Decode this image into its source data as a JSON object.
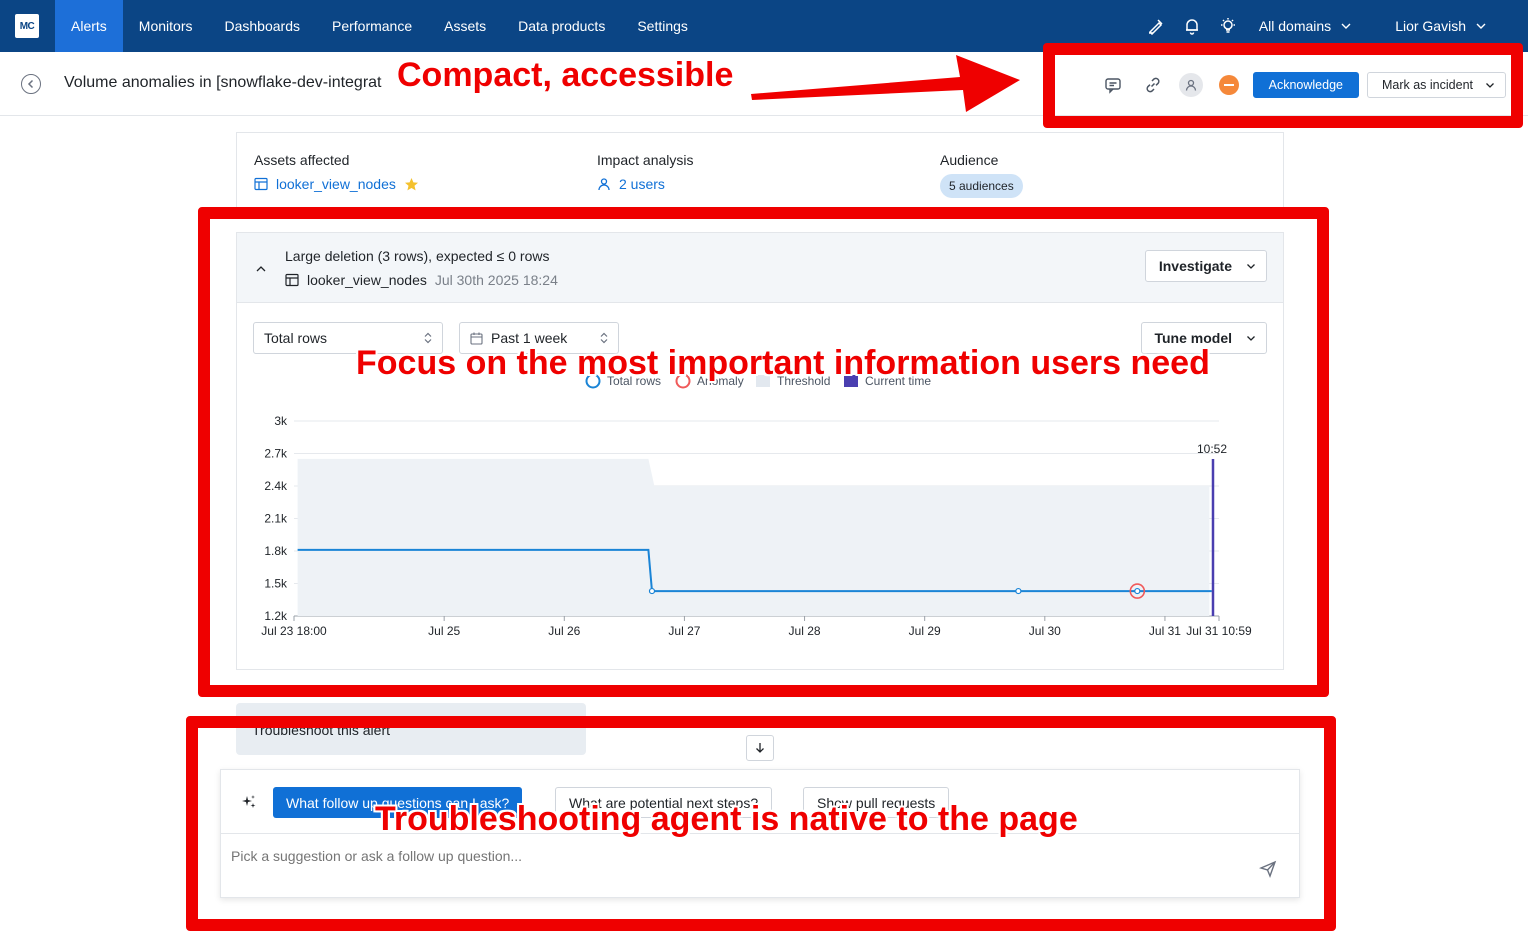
{
  "nav": {
    "logo": "MC",
    "items": [
      "Alerts",
      "Monitors",
      "Dashboards",
      "Performance",
      "Assets",
      "Data products",
      "Settings"
    ],
    "active_index": 0,
    "domain_select": "All domains",
    "user": "Lior Gavish"
  },
  "header": {
    "title": "Volume anomalies in [snowflake-dev-integrat",
    "acknowledge": "Acknowledge",
    "mark_incident": "Mark as incident"
  },
  "info": {
    "assets_label": "Assets affected",
    "asset_name": "looker_view_nodes",
    "impact_label": "Impact analysis",
    "impact_value": "2 users",
    "audience_label": "Audience",
    "audience_value": "5 audiences"
  },
  "anomaly": {
    "title": "Large deletion (3 rows), expected ≤ 0 rows",
    "table": "looker_view_nodes",
    "timestamp": "Jul 30th 2025 18:24",
    "investigate": "Investigate",
    "metric_select": "Total rows",
    "range_select": "Past 1 week",
    "tune_model": "Tune model"
  },
  "chart_data": {
    "type": "line",
    "legend": [
      "Total rows",
      "Anomaly",
      "Threshold",
      "Current time"
    ],
    "y_ticks": [
      "3k",
      "2.7k",
      "2.4k",
      "2.1k",
      "1.8k",
      "1.5k",
      "1.2k"
    ],
    "ylim": [
      1200,
      3000
    ],
    "x_ticks": [
      "Jul 23 18:00",
      "Jul 25",
      "Jul 26",
      "Jul 27",
      "Jul 28",
      "Jul 29",
      "Jul 30",
      "Jul 31",
      "Jul 31 10:59"
    ],
    "x_tick_days": [
      0,
      1.25,
      2.25,
      3.25,
      4.25,
      5.25,
      6.25,
      7.25,
      7.7
    ],
    "xlim_days": [
      0,
      7.7
    ],
    "series": [
      {
        "name": "Total rows",
        "x_days": [
          0.03,
          2.95,
          2.98,
          6.03,
          7.02,
          7.64
        ],
        "values": [
          1810,
          1810,
          1430,
          1430,
          1430,
          1430
        ]
      }
    ],
    "threshold": {
      "x_days": [
        0.03,
        2.95,
        3.0,
        7.62
      ],
      "upper": [
        2650,
        2650,
        2400,
        2400
      ],
      "lower": [
        1200,
        1200,
        1200,
        1200
      ]
    },
    "anomaly_point": {
      "x_day": 7.02,
      "value": 1430
    },
    "current_time": {
      "x_day": 7.65,
      "label": "10:52"
    },
    "colors": {
      "line": "#1a84d6",
      "threshold": "#eef2f6",
      "anomaly": "#f05a5a",
      "current": "#4a3fb0"
    }
  },
  "troubleshoot": {
    "pill_label": "Troubleshoot this alert",
    "suggestions": [
      "What follow up questions can I ask?",
      "What are potential next steps?",
      "Show pull requests"
    ],
    "input_placeholder": "Pick a suggestion or ask a follow up question..."
  },
  "annotations": {
    "top": "Compact, accessible",
    "middle": "Focus on the most important information users need",
    "bottom": "Troubleshooting agent is native to the page"
  }
}
